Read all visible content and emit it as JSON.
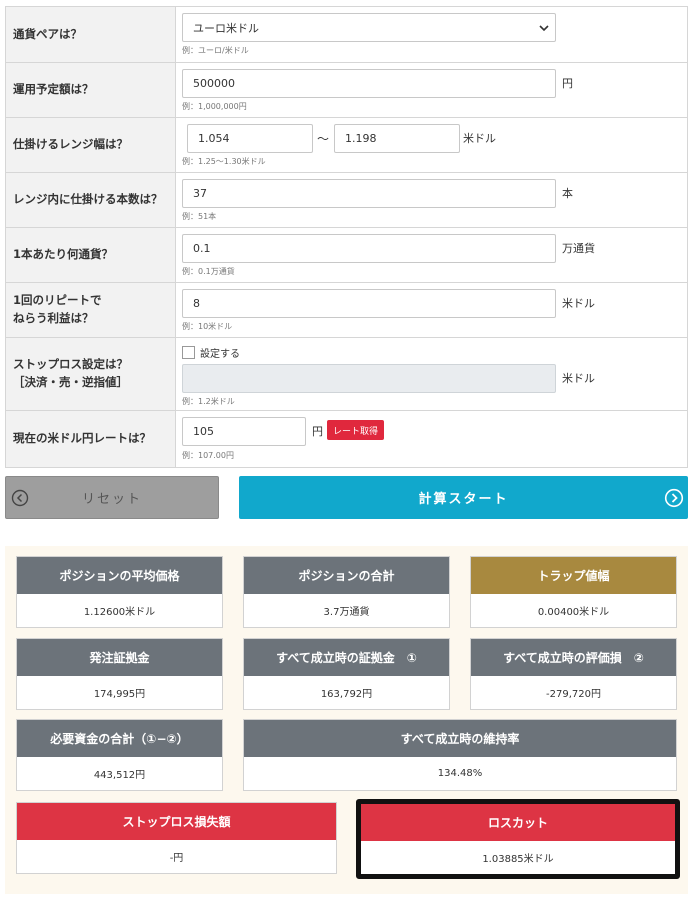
{
  "form": {
    "currency_pair": {
      "label": "通貨ペアは？",
      "value": "ユーロ米ドル",
      "hint": "例：ユーロ/米ドル"
    },
    "budget": {
      "label": "運用予定額は？",
      "value": "500000",
      "unit": "円",
      "hint": "例：1,000,000円"
    },
    "range": {
      "label": "仕掛けるレンジ幅は？",
      "low": "1.054",
      "separator": "～",
      "high": "1.198",
      "unit": "米ドル",
      "hint": "例：1.25～1.30米ドル"
    },
    "count": {
      "label": "レンジ内に仕掛ける本数は？",
      "value": "37",
      "unit": "本",
      "hint": "例：51本"
    },
    "amount": {
      "label": "1本あたり何通貨？",
      "value": "0.1",
      "unit": "万通貨",
      "hint": "例：0.1万通貨"
    },
    "profit": {
      "label_line1": "1回のリピートで",
      "label_line2": "ねらう利益は？",
      "value": "8",
      "unit": "米ドル",
      "hint": "例：10米ドル"
    },
    "stoploss": {
      "label_line1": "ストップロス設定は？",
      "label_line2": "［決済・売・逆指値］",
      "checkbox_label": "設定する",
      "checked": false,
      "value": "",
      "unit": "米ドル",
      "hint": "例：1.2米ドル"
    },
    "rate": {
      "label": "現在の米ドル円レートは？",
      "value": "105",
      "unit": "円",
      "button": "レート取得",
      "hint": "例：107.00円"
    }
  },
  "buttons": {
    "reset": "リセット",
    "start": "計算スタート"
  },
  "results": {
    "avg_price": {
      "title": "ポジションの平均価格",
      "value": "1.12600米ドル"
    },
    "total_position": {
      "title": "ポジションの合計",
      "value": "3.7万通貨"
    },
    "trap_width": {
      "title": "トラップ値幅",
      "value": "0.00400米ドル"
    },
    "order_margin": {
      "title": "発注証拠金",
      "value": "174,995円"
    },
    "full_margin": {
      "title": "すべて成立時の証拠金　①",
      "value": "163,792円"
    },
    "full_loss": {
      "title": "すべて成立時の評価損　②",
      "value": "-279,720円"
    },
    "required_total": {
      "title": "必要資金の合計（①−②）",
      "value": "443,512円"
    },
    "maintenance": {
      "title": "すべて成立時の維持率",
      "value": "134.48%"
    },
    "stoploss_loss": {
      "title": "ストップロス損失額",
      "value": "-円"
    },
    "losscut": {
      "title": "ロスカット",
      "value": "1.03885米ドル"
    }
  },
  "colors": {
    "header_gray": "#6c737a",
    "header_gold": "#a8893f",
    "header_red": "#dd3444",
    "start_button": "#11a8cc",
    "reset_button": "#9e9e9e",
    "rate_button": "#e0283d"
  }
}
